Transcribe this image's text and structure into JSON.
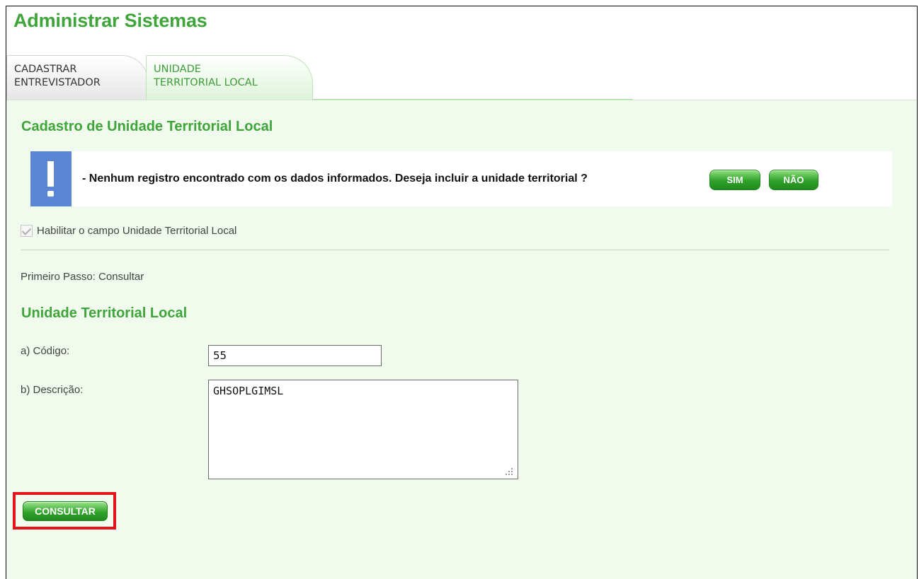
{
  "page": {
    "title": "Administrar Sistemas"
  },
  "tabs": [
    {
      "line1": "CADASTRAR",
      "line2": "ENTREVISTADOR"
    },
    {
      "line1": "UNIDADE",
      "line2": "TERRITORIAL LOCAL"
    }
  ],
  "section": {
    "title": "Cadastro de Unidade Territorial Local",
    "alert_text": "- Nenhum registro encontrado com os dados informados. Deseja incluir a unidade territorial ?",
    "sim_label": "SIM",
    "nao_label": "NÃO",
    "checkbox_label": "Habilitar o campo Unidade Territorial Local",
    "step_label": "Primeiro Passo: Consultar"
  },
  "form": {
    "title": "Unidade Territorial Local",
    "codigo_label": "a) Código:",
    "codigo_value": "55",
    "descricao_label": "b) Descrição:",
    "descricao_value": "GHSOPLGIMSL",
    "consultar_label": "CONSULTAR"
  },
  "colors": {
    "accent_green": "#3fa53a",
    "panel_bg": "#f0fbee",
    "alert_blue": "#5b86d4",
    "highlight_red": "#e4121b"
  },
  "icons": {
    "alert": "exclamation-icon",
    "resize": "resize-grip-icon",
    "check": "checkmark-icon"
  }
}
